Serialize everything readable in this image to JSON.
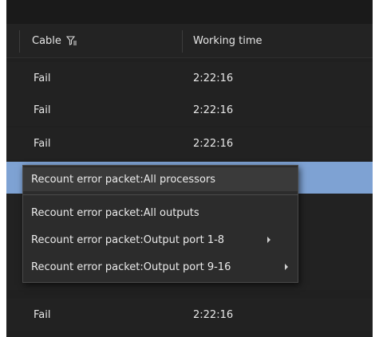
{
  "table": {
    "columns": [
      {
        "label": "Cable",
        "icon": "filter-icon"
      },
      {
        "label": "Working time"
      }
    ],
    "rows": [
      {
        "cable": "Fail",
        "working_time": "2:22:16"
      },
      {
        "cable": "Fail",
        "working_time": "2:22:16"
      },
      {
        "cable": "Fail",
        "working_time": "2:22:16"
      },
      {
        "cable": "",
        "working_time": "",
        "selected": true
      },
      {
        "cable": "",
        "working_time": ""
      },
      {
        "cable": "",
        "working_time": ""
      },
      {
        "cable": "",
        "working_time": ""
      },
      {
        "cable": "Fail",
        "working_time": "2:22:16"
      }
    ]
  },
  "context_menu": {
    "items": [
      {
        "label": "Recount error packet:All processors",
        "submenu": false
      },
      {
        "label": "Recount error packet:All outputs",
        "submenu": false
      },
      {
        "label": "Recount error packet:Output port 1-8",
        "submenu": true
      },
      {
        "label": "Recount error packet:Output port 9-16",
        "submenu": true
      }
    ]
  },
  "colors": {
    "background": "#202020",
    "selected_row": "#7ea2d3",
    "menu_background": "#2c2c2c",
    "text": "#e8e8e8"
  }
}
